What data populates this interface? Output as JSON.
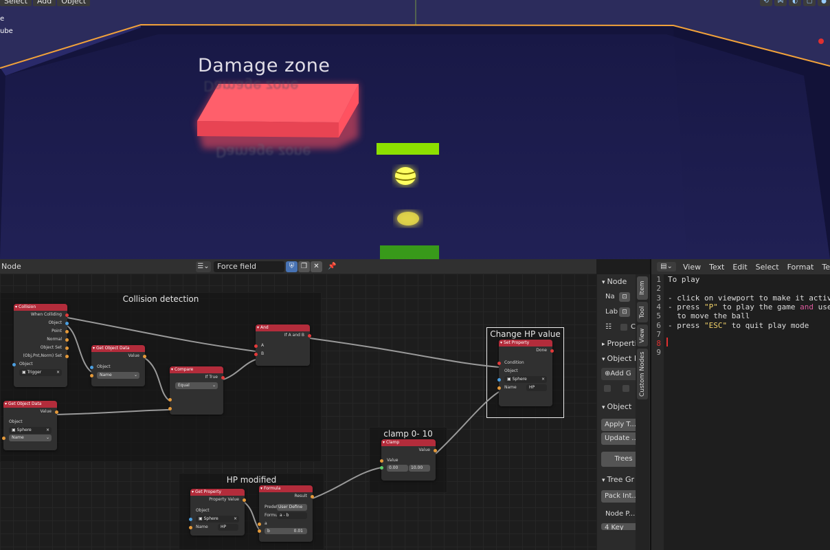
{
  "viewport": {
    "menus": [
      "Select",
      "Add",
      "Object"
    ],
    "side_labels": [
      "e",
      "ube"
    ],
    "damage_zone_label": "Damage zone"
  },
  "node_editor": {
    "editor_label": "Node",
    "tree_name": "Force field",
    "frames": {
      "collision": "Collision detection",
      "change_hp": "Change HP value",
      "clamp": "clamp 0- 10",
      "hp_modified": "HP modified"
    },
    "nodes": {
      "collision": {
        "title": "Collision",
        "outputs": [
          "When Colliding",
          "Object",
          "Point",
          "Normal",
          "Object Set",
          "(Obj,Pnt,Norm) Set"
        ],
        "input": "Object",
        "value": "Trigger"
      },
      "get_obj_data_1": {
        "title": "Get Object Data",
        "output": "Value",
        "input": "Object",
        "value": "Name"
      },
      "compare": {
        "title": "Compare",
        "output": "If True",
        "value": "Equal"
      },
      "and": {
        "title": "And",
        "output": "If A and B",
        "inputs": [
          "A",
          "B"
        ]
      },
      "get_obj_data_2": {
        "title": "Get Object Data",
        "output": "Value",
        "input": "Object",
        "object": "Sphere",
        "value": "Name"
      },
      "set_property": {
        "title": "Set Property",
        "output": "Done",
        "inputs": [
          "Condition",
          "Object"
        ],
        "object": "Sphere",
        "name_label": "Name",
        "name_value": "HP"
      },
      "clamp": {
        "title": "Clamp",
        "output": "Value",
        "input": "Value",
        "min": "0.00",
        "max": "10.00"
      },
      "get_property": {
        "title": "Get Property",
        "output": "Property Value",
        "input": "Object",
        "object": "Sphere",
        "name_label": "Name",
        "name_value": "HP"
      },
      "formula": {
        "title": "Formula",
        "output": "Result",
        "predef_label": "Predef",
        "predef_value": "User Define",
        "formula_label": "Formu",
        "formula_value": "a - b",
        "a": "a",
        "b_label": "b",
        "b_value": "0.01"
      }
    }
  },
  "sidebar": {
    "node_section": "Node",
    "name_label": "Na",
    "label_label": "Lab",
    "properties": "Properti",
    "object_p": "Object P",
    "add_g": "Add G",
    "object_section": "Object",
    "apply": "Apply T...",
    "update": "Update ...",
    "trees": "Trees",
    "tree_gr": "Tree Gr",
    "pack": "Pack Int...",
    "node_p": "Node P...",
    "key": "4 Key",
    "c_label": "C",
    "tabs": [
      "Item",
      "Tool",
      "View",
      "Custom Nodes"
    ]
  },
  "text_editor": {
    "menus": [
      "View",
      "Text",
      "Edit",
      "Select",
      "Format",
      "Templa"
    ],
    "lines": [
      {
        "n": "1",
        "segs": [
          {
            "t": "To play",
            "c": ""
          }
        ]
      },
      {
        "n": "2",
        "segs": []
      },
      {
        "n": "3",
        "segs": [
          {
            "t": "- click on viewport to make it active",
            "c": ""
          }
        ]
      },
      {
        "n": "4",
        "segs": [
          {
            "t": "- press ",
            "c": ""
          },
          {
            "t": "\"P\"",
            "c": "str"
          },
          {
            "t": " to play the game ",
            "c": ""
          },
          {
            "t": "and",
            "c": "kw"
          },
          {
            "t": " use Q",
            "c": ""
          }
        ]
      },
      {
        "n": "5",
        "segs": [
          {
            "t": "  to move the ball",
            "c": ""
          }
        ]
      },
      {
        "n": "6",
        "segs": [
          {
            "t": "- press ",
            "c": ""
          },
          {
            "t": "\"ESC\"",
            "c": "str"
          },
          {
            "t": " to quit play mode",
            "c": ""
          }
        ]
      },
      {
        "n": "7",
        "segs": []
      },
      {
        "n": "8",
        "segs": []
      },
      {
        "n": "9",
        "segs": []
      }
    ]
  }
}
